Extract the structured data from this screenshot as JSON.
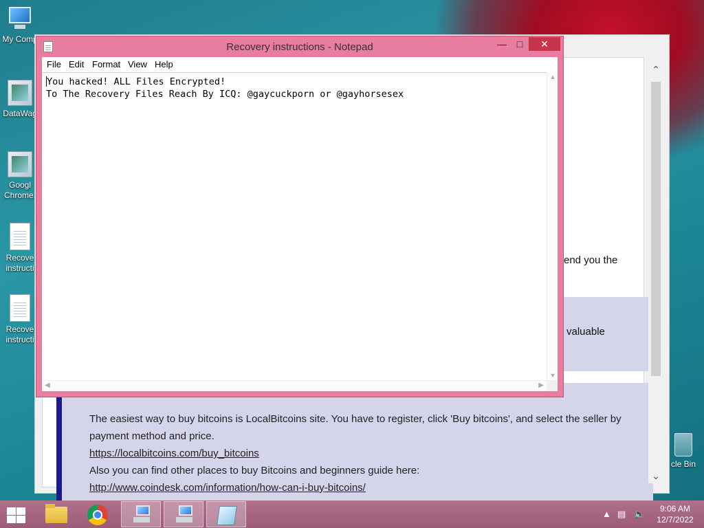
{
  "desktop": {
    "icons": [
      {
        "label": "My Comp"
      },
      {
        "label": "DataWag"
      },
      {
        "label": "Googl Chrome."
      },
      {
        "label": "Recove instructi"
      },
      {
        "label": "Recove instructi"
      }
    ],
    "recycle_label": "cle Bin"
  },
  "background_window": {
    "partial_text_1": "end you the",
    "partial_text_2": "valuable",
    "panel": {
      "line1": "The easiest way to buy bitcoins is LocalBitcoins site. You have to register, click 'Buy bitcoins', and select the seller by",
      "line2": "payment method and price.",
      "link1": "https://localbitcoins.com/buy_bitcoins",
      "line3": "Also you can find other places to buy Bitcoins and beginners guide here:",
      "link2": "http://www.coindesk.com/information/how-can-i-buy-bitcoins/"
    }
  },
  "notepad": {
    "title": "Recovery instructions - Notepad",
    "menu": {
      "file": "File",
      "edit": "Edit",
      "format": "Format",
      "view": "View",
      "help": "Help"
    },
    "line1": "You hacked! ALL Files Encrypted!",
    "line2": "To The Recovery Files Reach By ICQ: @gaycuckporn or @gayhorsesex"
  },
  "taskbar": {
    "clock_time": "9:06 AM",
    "clock_date": "12/7/2022",
    "accent_color": "#a4647f"
  },
  "icons": {
    "start": "windows-logo-icon",
    "explorer": "folder-icon",
    "chrome": "chrome-icon",
    "network": "network-computer-icon",
    "notepad": "notepad-icon"
  }
}
